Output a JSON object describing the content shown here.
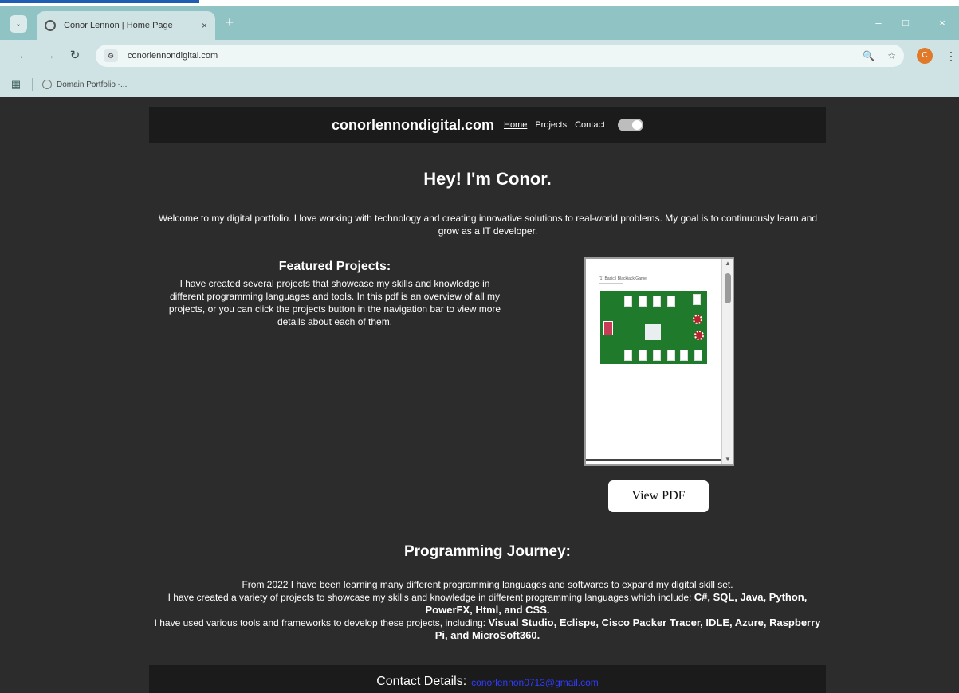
{
  "browser": {
    "tab_title": "Conor Lennon | Home Page",
    "tab_close": "×",
    "new_tab": "+",
    "url": "conorlennondigital.com",
    "bookmark": "Domain Portfolio -...",
    "profile_initial": "C",
    "window_controls": [
      "–",
      "□",
      "×"
    ]
  },
  "nav": {
    "brand": "conorlennondigital.com",
    "links": [
      "Home",
      "Projects",
      "Contact"
    ]
  },
  "hero": {
    "title": "Hey! I'm Conor.",
    "welcome": "Welcome to my digital portfolio. I love working with technology and creating innovative solutions to real-world problems. My goal is to continuously learn and grow as a IT developer."
  },
  "featured": {
    "heading": "Featured Projects:",
    "text": "I have created several projects that showcase my skills and knowledge in different programming languages and tools. In this pdf is an overview of all my projects, or you can click the projects button in the navigation bar to view more details about each of them.",
    "pdf_page_title": "(1) Basic | Blackjack Game",
    "button": "View PDF"
  },
  "journey": {
    "heading": "Programming Journey:",
    "line1": "From 2022 I have been learning many different programming languages and softwares to expand my digital skill set.",
    "line2_prefix": "I have created a variety of projects to showcase my skills and knowledge in different programming languages which include:",
    "languages": "C#, SQL, Java, Python, PowerFX, Html, and CSS.",
    "line3_prefix": "I have used various tools and frameworks to develop these projects, including:",
    "tools": "Visual Studio, Eclispe, Cisco Packer Tracer, IDLE, Azure, Raspberry Pi, and MicroSoft360."
  },
  "footer": {
    "label": "Contact Details:",
    "email": "conorlennon0713@gmail.com"
  },
  "colors": {
    "page_bg": "#2c2c2c",
    "panel_bg": "#1b1b1b",
    "link": "#2f3cff",
    "chrome_accent": "#8fc3c4"
  }
}
